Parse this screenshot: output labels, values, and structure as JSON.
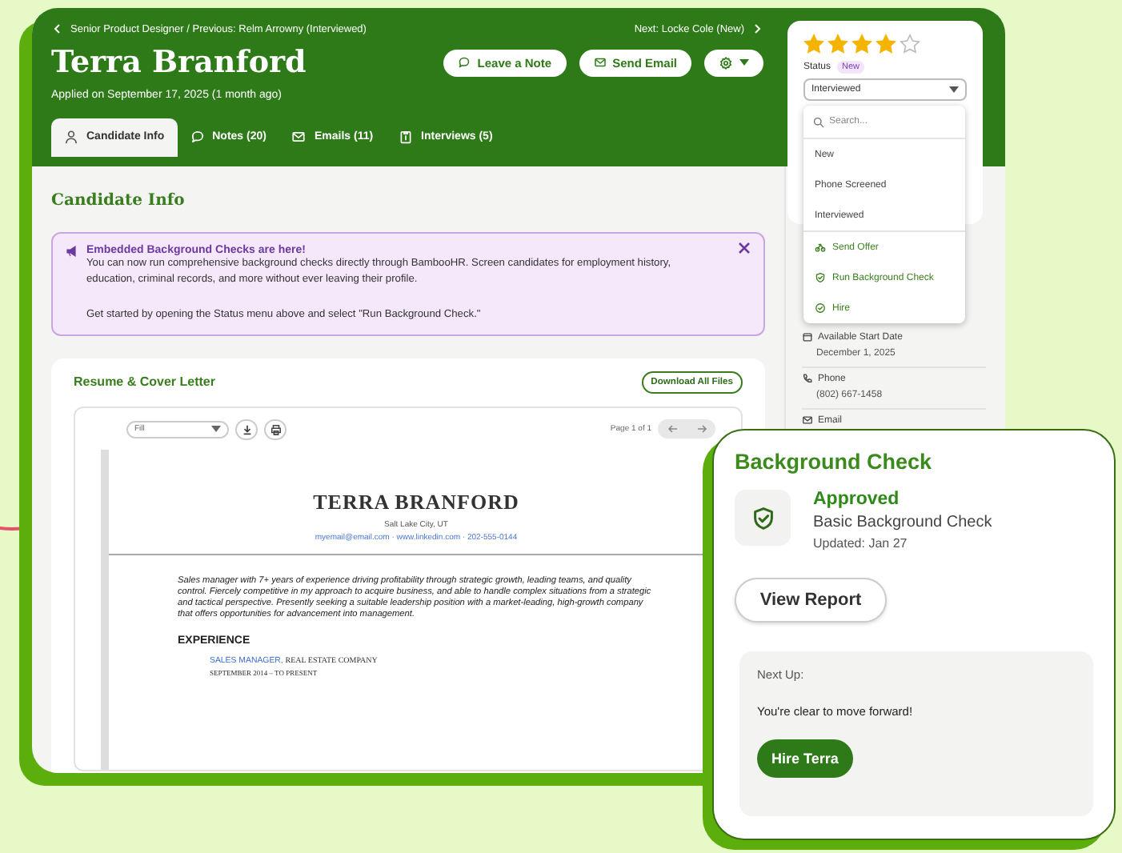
{
  "header": {
    "breadcrumb": "Senior Product Designer / Previous: Relm Arrowny (Interviewed)",
    "next": "Next: Locke Cole (New)",
    "name": "Terra Branford",
    "applied": "Applied on September 17, 2025 (1 month ago)",
    "buttons": [
      {
        "kind": "note",
        "label": "Leave a Note"
      },
      {
        "kind": "email",
        "label": "Send Email"
      },
      {
        "kind": "settings"
      }
    ]
  },
  "tabs": [
    {
      "kind": "person",
      "label": "Candidate Info",
      "selected": true
    },
    {
      "kind": "note",
      "label": "Notes (20)",
      "selected": false
    },
    {
      "kind": "email",
      "label": "Emails (11)",
      "selected": false
    },
    {
      "kind": "interview",
      "label": "Interviews (5)",
      "selected": false
    }
  ],
  "section_title": "Candidate Info",
  "banner": {
    "title": "Embedded Background Checks are here!",
    "body": "You can now run comprehensive background checks directly through BambooHR. Screen candidates for employment history, education, criminal records, and more without ever leaving their profile.",
    "footer": "Get started by opening the Status menu above and select \"Run Background Check.\""
  },
  "resume": {
    "title": "Resume & Cover Letter",
    "download_button": "Download All Files",
    "viewer": {
      "zoom": "Fill",
      "page": "Page 1 of 1"
    },
    "document": {
      "name": "TERRA BRANFORD",
      "location": "Salt Lake City, UT",
      "contact": "myemail@email.com · www.linkedin.com · 202-555-0144",
      "summary": "Sales manager with 7+ years of experience driving profitability through strategic growth, leading teams, and quality control. Fiercely competitive in my approach to acquire business, and able to handle complex situations from a strategic and tactical perspective. Presently seeking a suitable leadership position with a market-leading, high-growth company that offers opportunities for advancement into management.",
      "section": "EXPERIENCE",
      "job_title": "SALES MANAGER,",
      "company": "REAL ESTATE COMPANY",
      "dates": "SEPTEMBER 2014 – TO PRESENT"
    }
  },
  "rating": {
    "stars": 4
  },
  "status": {
    "label": "Status",
    "badge": "New",
    "value": "Interviewed"
  },
  "status_menu": {
    "placeholder": "Search...",
    "options": [
      {
        "label": "New",
        "selected": false
      },
      {
        "label": "Phone Screened",
        "selected": false
      },
      {
        "label": "Interviewed",
        "selected": false
      }
    ],
    "actions": [
      {
        "kind": "offer",
        "label": "Send Offer"
      },
      {
        "kind": "check",
        "label": "Run Background Check"
      },
      {
        "kind": "hire",
        "label": "Hire"
      }
    ]
  },
  "sidebar": {
    "fields": [
      {
        "kind": "calendar",
        "label": "Available Start Date",
        "value": "December 1, 2025"
      },
      {
        "kind": "phone",
        "label": "Phone",
        "value": "(802) 667-1458"
      },
      {
        "kind": "email",
        "label": "Email"
      }
    ]
  },
  "background_check": {
    "title": "Background Check",
    "status": "Approved",
    "package": "Basic Background Check",
    "updated": "Updated: Jan 27",
    "report_button": "View Report",
    "next_up": {
      "label": "Next Up:",
      "message": "You're clear to move forward!",
      "button": "Hire Terra"
    }
  }
}
